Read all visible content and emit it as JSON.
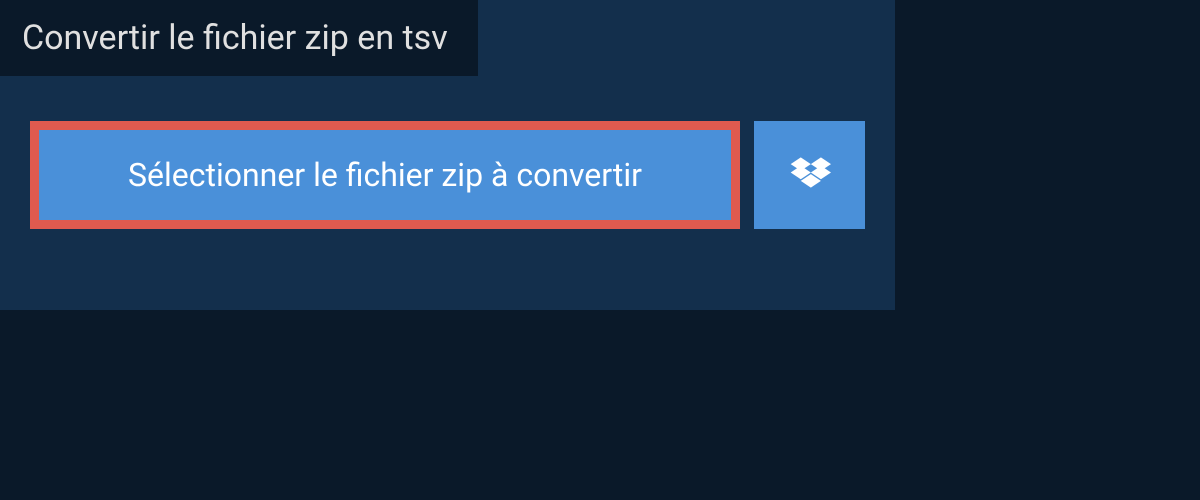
{
  "header": {
    "title": "Convertir le fichier zip en tsv"
  },
  "buttons": {
    "select_file_label": "Sélectionner le fichier zip à convertir"
  },
  "colors": {
    "background_dark": "#0a1929",
    "panel": "#132f4c",
    "button_primary": "#4a90d9",
    "highlight_border": "#e05a4f",
    "text_light": "#e0e0e0",
    "text_white": "#ffffff"
  }
}
